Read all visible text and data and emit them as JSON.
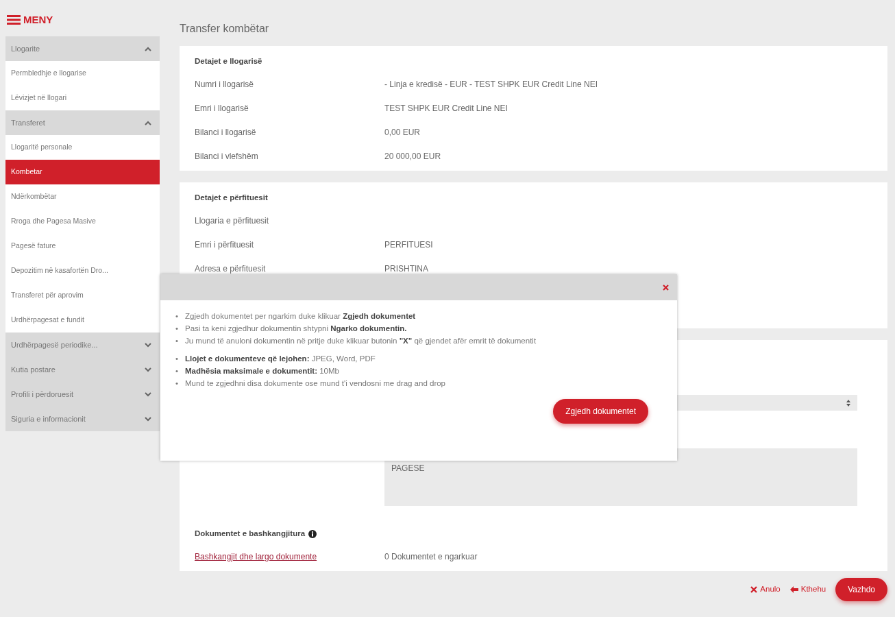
{
  "menu": {
    "title": "MENY"
  },
  "sidebar": [
    {
      "label": "Llogarite",
      "expanded": true,
      "items": [
        {
          "label": "Permbledhje e llogarise",
          "selected": false
        },
        {
          "label": "Lëvizjet në llogari",
          "selected": false
        }
      ]
    },
    {
      "label": "Transferet",
      "expanded": true,
      "items": [
        {
          "label": "Llogaritë personale",
          "selected": false
        },
        {
          "label": "Kombetar",
          "selected": true
        },
        {
          "label": "Ndërkombëtar",
          "selected": false
        },
        {
          "label": "Rroga dhe Pagesa Masive",
          "selected": false
        },
        {
          "label": "Pagesë fature",
          "selected": false
        },
        {
          "label": "Depozitim në kasafortën Dro...",
          "selected": false
        },
        {
          "label": "Transferet për aprovim",
          "selected": false
        },
        {
          "label": "Urdhërpagesat e fundit",
          "selected": false
        }
      ]
    },
    {
      "label": "Urdhërpagesë periodike...",
      "expanded": false
    },
    {
      "label": "Kutia postare",
      "expanded": false
    },
    {
      "label": "Profili i përdoruesit",
      "expanded": false
    },
    {
      "label": "Siguria e informacionit",
      "expanded": false
    }
  ],
  "page_title": "Transfer kombëtar",
  "account_details": {
    "title": "Detajet e llogarisë",
    "rows": [
      {
        "label": "Numri i llogarisë",
        "value": "- Linja e kredisë - EUR - TEST SHPK EUR Credit Line NEI"
      },
      {
        "label": "Emri i llogarisë",
        "value": "TEST SHPK EUR Credit Line NEI"
      },
      {
        "label": "Bilanci i llogarisë",
        "value": "0,00 EUR"
      },
      {
        "label": "Bilanci i vlefshëm",
        "value": "20 000,00 EUR"
      }
    ]
  },
  "beneficiary_details": {
    "title": "Detajet e përfituesit",
    "rows": [
      {
        "label": "Llogaria e përfituesit",
        "value": ""
      },
      {
        "label": "Emri i përfituesit",
        "value": "PERFITUESI"
      },
      {
        "label": "Adresa e përfituesit",
        "value": "PRISHTINA"
      }
    ]
  },
  "payment": {
    "description": "PAGESE"
  },
  "attachments": {
    "title": "Dokumentet e bashkangjitura",
    "link": "Bashkangjit dhe largo dokumente",
    "count": "0 Dokumentet e ngarkuar"
  },
  "actions": [
    {
      "label": "Anulo",
      "kind": "cancel"
    },
    {
      "label": "Kthehu",
      "kind": "back"
    },
    {
      "label": "Vazhdo",
      "kind": "primary"
    }
  ],
  "modal": {
    "lists": [
      [
        {
          "bullet": "•",
          "text": "Zgjedh dokumentet per ngarkim duke klikuar **Zgjedh dokumentet**"
        },
        {
          "bullet": "•",
          "text": "Pasi ta keni zgjedhur dokumentin shtypni **Ngarko dokumentin.**"
        },
        {
          "bullet": "•",
          "text": "Ju mund të anuloni dokumentin në pritje duke klikuar butonin **\"X\"** që gjendet afër emrit të dokumentit"
        }
      ],
      [
        {
          "bullet": "•",
          "text": "**Llojet e dokumenteve që lejohen:** JPEG, Word, PDF"
        },
        {
          "bullet": "•",
          "text": "**Madhësia maksimale e dokumentit:** 10Mb"
        },
        {
          "bullet": "•",
          "text": "Mund te zgjedhni disa dokumente ose mund t'i vendosni me drag and drop"
        }
      ]
    ],
    "button": "Zgjedh dokumentet"
  }
}
